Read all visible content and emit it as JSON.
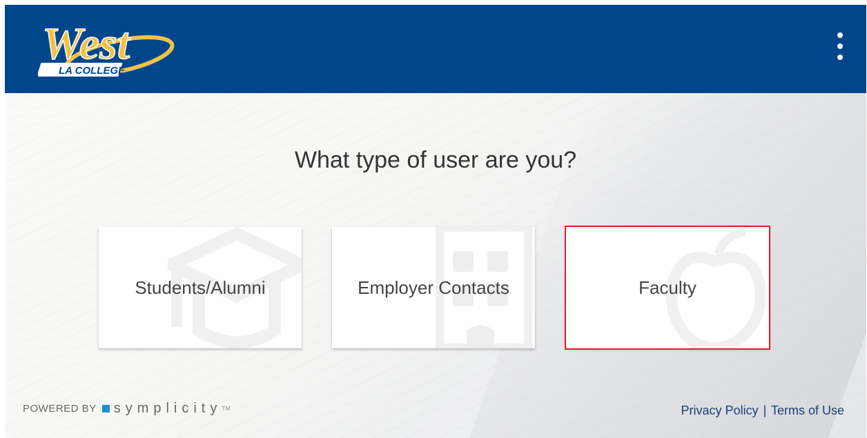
{
  "header": {
    "logo_text": "West",
    "logo_subtext": "LA COLLEGE",
    "menu_icon": "more-vertical-icon"
  },
  "main": {
    "title": "What type of user are you?",
    "cards": [
      {
        "label": "Students/Alumni",
        "icon": "graduation-cap-icon"
      },
      {
        "label": "Employer Contacts",
        "icon": "building-icon"
      },
      {
        "label": "Faculty",
        "icon": "apple-icon"
      }
    ]
  },
  "footer": {
    "powered_by": "POWERED BY",
    "brand": "symplicity",
    "brand_mark": "TM",
    "privacy_label": "Privacy Policy",
    "separator": "|",
    "terms_label": "Terms of Use"
  },
  "colors": {
    "header_bg": "#00468b",
    "logo_gold": "#f0c24b",
    "link": "#1d3f73",
    "selected_outline": "#e31b23",
    "symplicity_blue": "#1a8fd1"
  }
}
